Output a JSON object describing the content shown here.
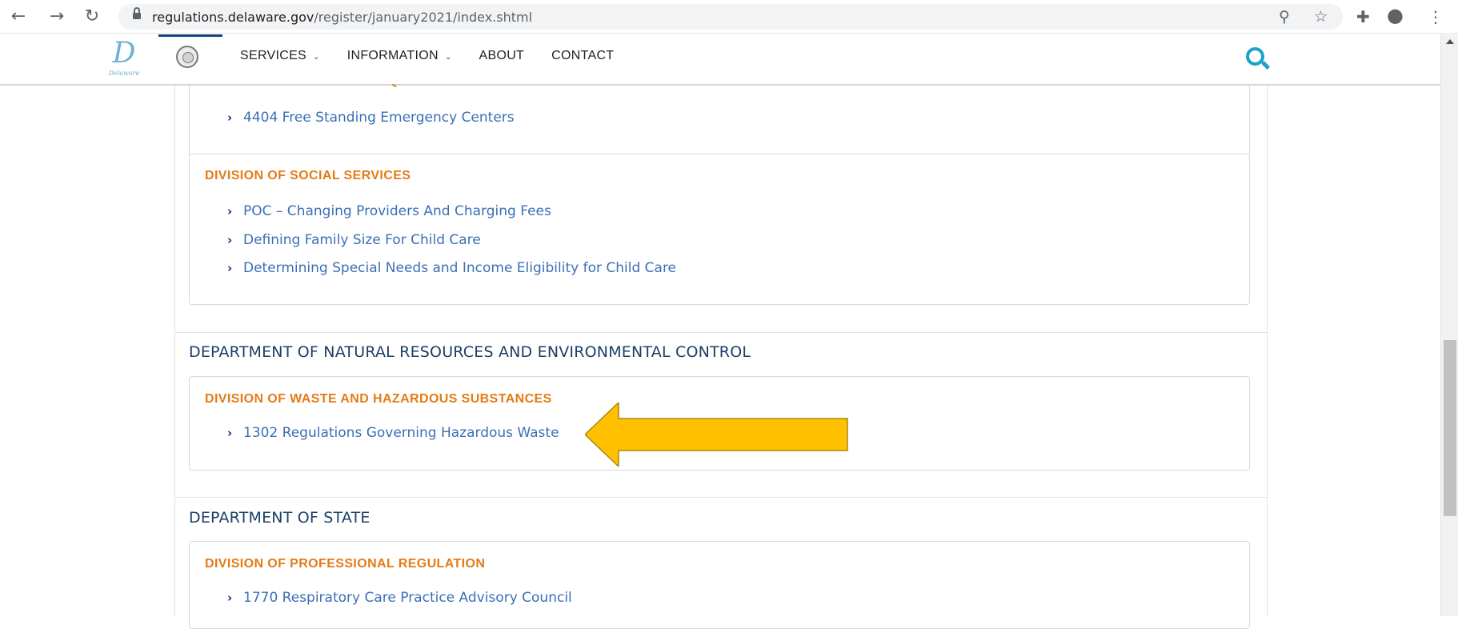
{
  "browser": {
    "url_host": "regulations.delaware.gov",
    "url_path": "/register/january2021/index.shtml",
    "icons": [
      "back-icon",
      "forward-icon",
      "reload-icon",
      "lock-icon",
      "zoom-icon",
      "star-icon",
      "extensions-icon",
      "profile-icon",
      "menu-icon"
    ]
  },
  "site": {
    "logo_sub": "Delaware",
    "nav": [
      {
        "label": "SERVICES"
      },
      {
        "label": "INFORMATION"
      },
      {
        "label": "ABOUT"
      },
      {
        "label": "CONTACT"
      }
    ],
    "accent_color": "#1aa3c7"
  },
  "content": {
    "cut_off_division": "DIVISION OF HEALTH CARE QUALITY",
    "health_links": [
      "4404 Free Standing Emergency Centers"
    ],
    "social_services": {
      "title": "DIVISION OF SOCIAL SERVICES",
      "links": [
        "POC – Changing Providers And Charging Fees",
        "Defining Family Size For Child Care",
        "Determining Special Needs and Income Eligibility for Child Care"
      ]
    },
    "dnrec": {
      "title": "DEPARTMENT OF NATURAL RESOURCES AND ENVIRONMENTAL CONTROL",
      "division": "DIVISION OF WASTE AND HAZARDOUS SUBSTANCES",
      "links": [
        "1302 Regulations Governing Hazardous Waste"
      ]
    },
    "state": {
      "title": "DEPARTMENT OF STATE",
      "division": "DIVISION OF PROFESSIONAL REGULATION",
      "links": [
        "1770 Respiratory Care Practice Advisory Council"
      ]
    }
  },
  "colors": {
    "division_title": "#e37b16",
    "department_title": "#1b3f66",
    "link": "#3b6fb6",
    "annotation_arrow": "#ffc000"
  }
}
